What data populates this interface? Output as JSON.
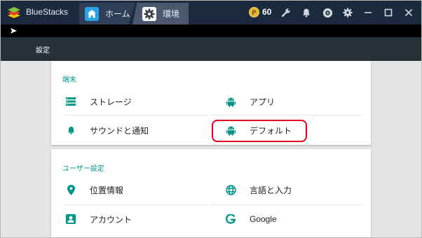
{
  "titlebar": {
    "app_name": "BlueStacks",
    "tabs": [
      {
        "label": "ホーム",
        "icon": "home-icon"
      },
      {
        "label": "環境",
        "icon": "gear-icon"
      }
    ],
    "coins": "60",
    "coin_symbol": "P",
    "buttons": [
      "wrench-icon",
      "bell-icon",
      "account-icon",
      "gear-icon",
      "minimize-icon",
      "maximize-icon",
      "close-icon"
    ]
  },
  "settings_header": {
    "title": "設定"
  },
  "sections": {
    "device": {
      "title": "端末",
      "items": [
        {
          "label": "ストレージ",
          "icon": "storage-icon"
        },
        {
          "label": "アプリ",
          "icon": "android-icon"
        },
        {
          "label": "サウンドと通知",
          "icon": "bell-icon"
        },
        {
          "label": "デフォルト",
          "icon": "android-icon"
        }
      ]
    },
    "user": {
      "title": "ユーザー設定",
      "items": [
        {
          "label": "位置情報",
          "icon": "location-icon"
        },
        {
          "label": "言語と入力",
          "icon": "globe-icon"
        },
        {
          "label": "アカウント",
          "icon": "account-box-icon"
        },
        {
          "label": "Google",
          "icon": "google-icon"
        }
      ]
    }
  },
  "colors": {
    "accent": "#009688",
    "titlebar": "#1c2a3d",
    "header": "#263238",
    "highlight": "#e0001b"
  }
}
